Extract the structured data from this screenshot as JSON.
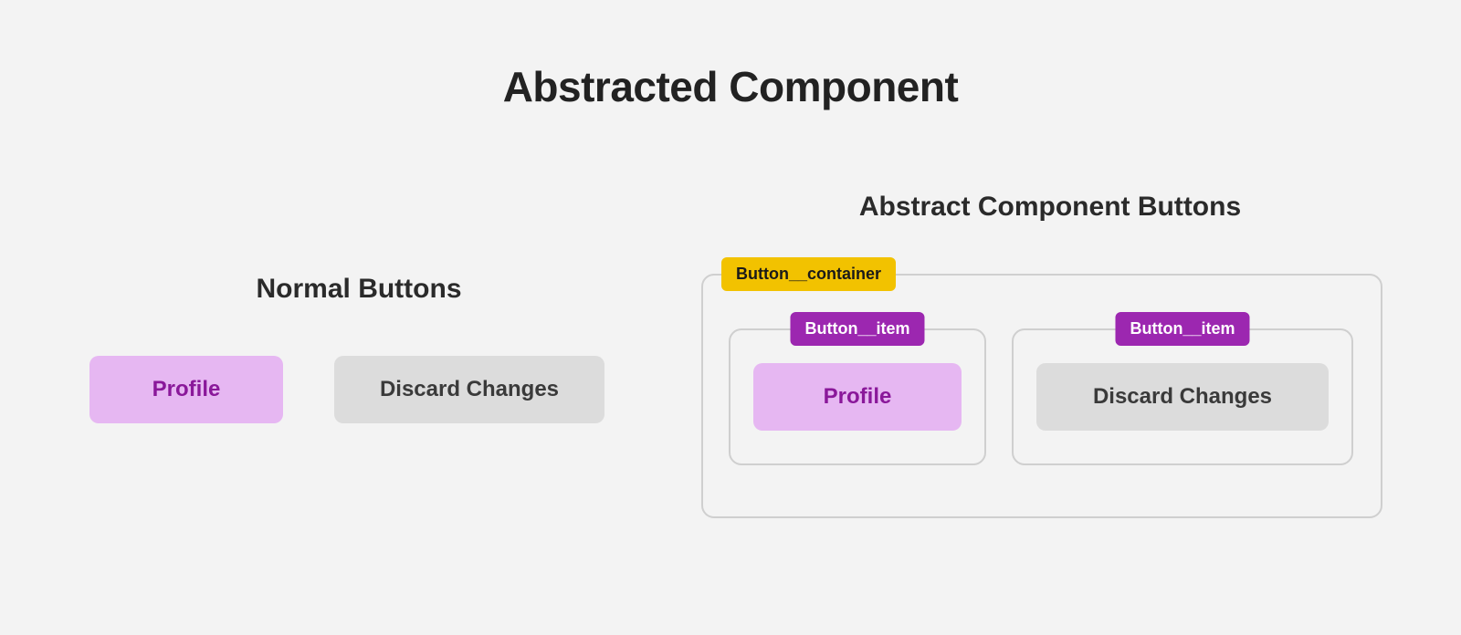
{
  "title": "Abstracted Component",
  "left": {
    "heading": "Normal Buttons",
    "buttons": {
      "primary": "Profile",
      "secondary": "Discard Changes"
    }
  },
  "right": {
    "heading": "Abstract Component Buttons",
    "container_label": "Button__container",
    "items": [
      {
        "label": "Button__item",
        "button": "Profile"
      },
      {
        "label": "Button__item",
        "button": "Discard Changes"
      }
    ]
  },
  "colors": {
    "primary_bg": "#e6b7f2",
    "primary_fg": "#8a189a",
    "secondary_bg": "#dcdcdc",
    "secondary_fg": "#3a3a3a",
    "tag_yellow": "#f2c200",
    "tag_purple": "#9c27b0",
    "outline": "#cfcfcf",
    "page_bg": "#f3f3f3"
  }
}
